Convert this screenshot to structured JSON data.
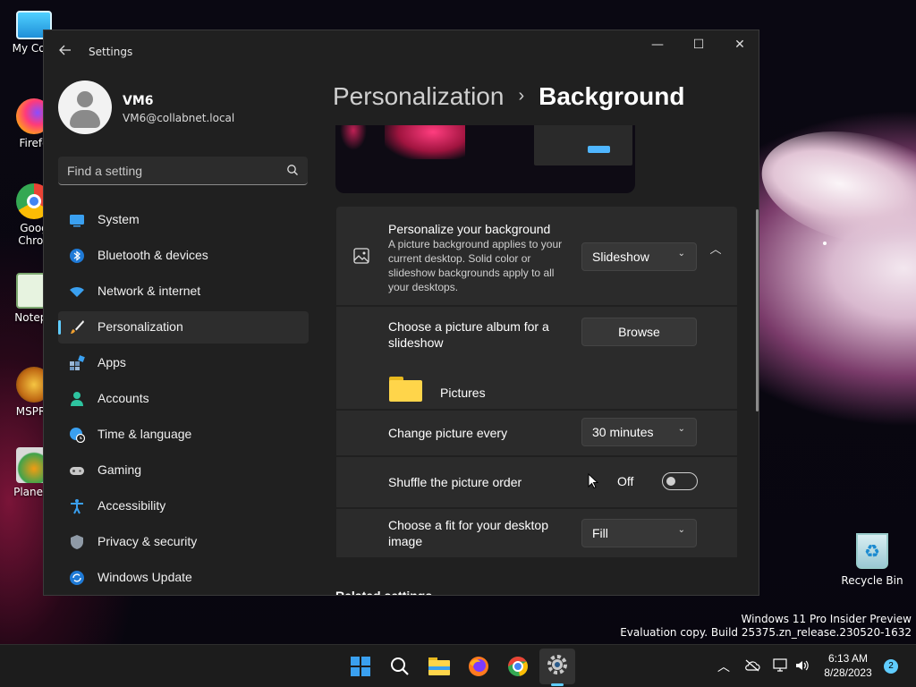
{
  "desktop": {
    "icons": [
      {
        "label": "My Com"
      },
      {
        "label": "Firefo"
      },
      {
        "label": "Goog Chron"
      },
      {
        "label": "Notepa"
      },
      {
        "label": "MSPRe"
      },
      {
        "label": "PlanetV"
      }
    ],
    "recycle_bin": "Recycle Bin",
    "watermark_line1": "Windows 11 Pro Insider Preview",
    "watermark_line2": "Evaluation copy. Build 25375.zn_release.230520-1632"
  },
  "window": {
    "title": "Settings",
    "controls": {
      "minimize": "—",
      "maximize": "☐",
      "close": "✕"
    }
  },
  "profile": {
    "name": "VM6",
    "email": "VM6@collabnet.local"
  },
  "search": {
    "placeholder": "Find a setting"
  },
  "sidebar": {
    "items": [
      {
        "label": "System",
        "icon": "monitor-icon"
      },
      {
        "label": "Bluetooth & devices",
        "icon": "bluetooth-icon"
      },
      {
        "label": "Network & internet",
        "icon": "wifi-icon"
      },
      {
        "label": "Personalization",
        "icon": "brush-icon",
        "active": true
      },
      {
        "label": "Apps",
        "icon": "apps-icon"
      },
      {
        "label": "Accounts",
        "icon": "person-icon"
      },
      {
        "label": "Time & language",
        "icon": "globe-clock-icon"
      },
      {
        "label": "Gaming",
        "icon": "gamepad-icon"
      },
      {
        "label": "Accessibility",
        "icon": "accessibility-icon"
      },
      {
        "label": "Privacy & security",
        "icon": "shield-icon"
      },
      {
        "label": "Windows Update",
        "icon": "update-icon"
      }
    ]
  },
  "breadcrumb": {
    "parent": "Personalization",
    "separator": "›",
    "current": "Background"
  },
  "background": {
    "title": "Personalize your background",
    "description": "A picture background applies to your current desktop. Solid color or slideshow backgrounds apply to all your desktops.",
    "type_value": "Slideshow",
    "album_title": "Choose a picture album for a slideshow",
    "browse_label": "Browse",
    "folder_label": "Pictures",
    "interval_title": "Change picture every",
    "interval_value": "30 minutes",
    "shuffle_title": "Shuffle the picture order",
    "shuffle_state": "Off",
    "fit_title": "Choose a fit for your desktop image",
    "fit_value": "Fill",
    "related": "Related settings"
  },
  "taskbar": {
    "clock_time": "6:13 AM",
    "clock_date": "8/28/2023",
    "notifications": "2"
  },
  "colors": {
    "accent": "#60cdff",
    "window_bg": "#202020",
    "card_bg": "#2b2b2b"
  }
}
